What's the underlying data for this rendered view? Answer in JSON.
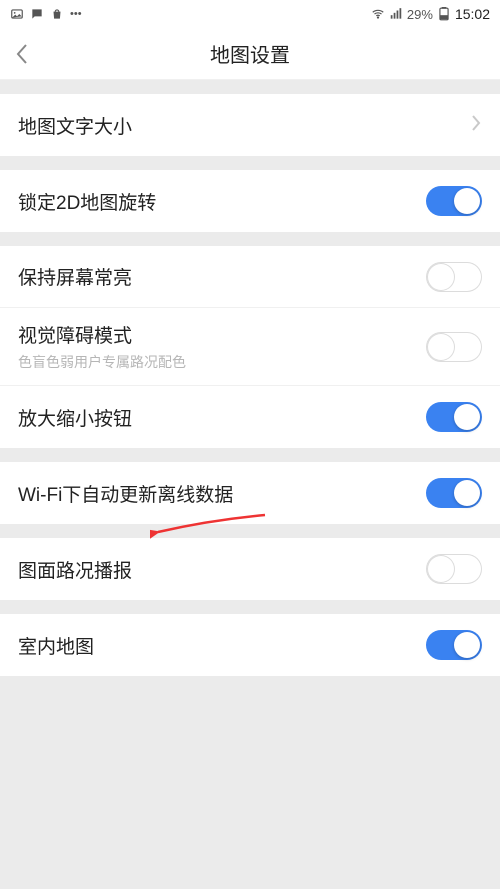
{
  "status": {
    "battery_pct": "29%",
    "time": "15:02"
  },
  "header": {
    "title": "地图设置"
  },
  "rows": {
    "text_size": {
      "label": "地图文字大小"
    },
    "lock_2d": {
      "label": "锁定2D地图旋转",
      "on": true
    },
    "keep_screen": {
      "label": "保持屏幕常亮",
      "on": false
    },
    "a11y": {
      "label": "视觉障碍模式",
      "sub": "色盲色弱用户专属路况配色",
      "on": false
    },
    "zoom_btns": {
      "label": "放大缩小按钮",
      "on": true
    },
    "wifi_update": {
      "label": "Wi-Fi下自动更新离线数据",
      "on": true
    },
    "traffic_tts": {
      "label": "图面路况播报",
      "on": false
    },
    "indoor": {
      "label": "室内地图",
      "on": true
    }
  },
  "colors": {
    "accent": "#3a82f1"
  }
}
